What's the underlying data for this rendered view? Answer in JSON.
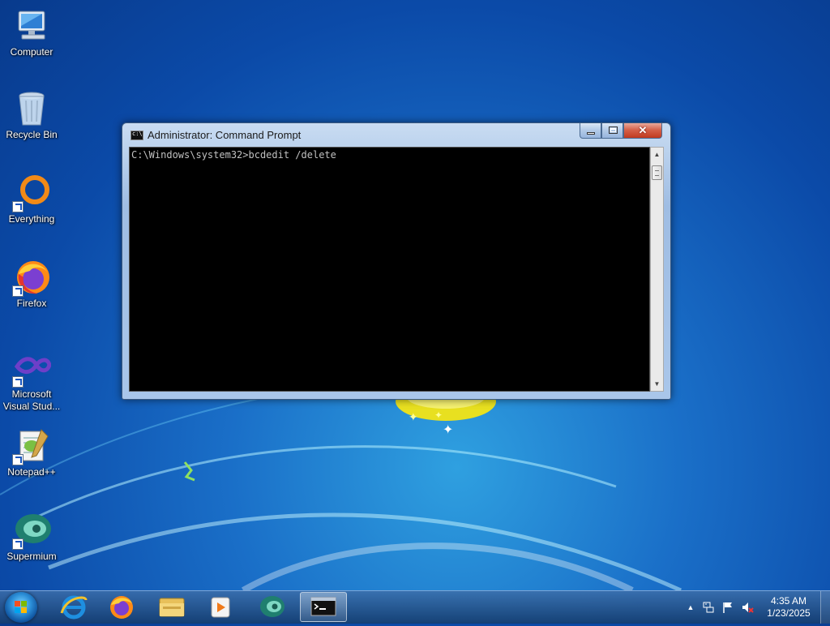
{
  "desktop": {
    "icons": [
      {
        "label": "Computer",
        "icon": "computer-icon"
      },
      {
        "label": "Recycle Bin",
        "icon": "recycle-bin-icon"
      },
      {
        "label": "Everything",
        "icon": "everything-icon"
      },
      {
        "label": "Firefox",
        "icon": "firefox-icon"
      },
      {
        "label": "Microsoft Visual Stud...",
        "icon": "visual-studio-icon"
      },
      {
        "label": "Notepad++",
        "icon": "notepadpp-icon"
      },
      {
        "label": "Supermium",
        "icon": "supermium-icon"
      }
    ]
  },
  "cmd_window": {
    "title": "Administrator:  Command Prompt",
    "console_text": "C:\\Windows\\system32>bcdedit /delete",
    "close_glyph": "✕",
    "up_glyph": "▲",
    "down_glyph": "▼"
  },
  "taskbar": {
    "pinned": [
      "internet-explorer-icon",
      "firefox-icon",
      "file-explorer-icon",
      "media-player-icon",
      "supermium-icon",
      "command-prompt-icon"
    ],
    "tray": {
      "show_hidden_glyph": "▲",
      "time": "4:35 AM",
      "date": "1/23/2025"
    }
  },
  "colors": {
    "desktop_blue": "#1a6fc8",
    "console_bg": "#000000",
    "console_text": "#c0c0c0",
    "close_red": "#c0391f"
  }
}
